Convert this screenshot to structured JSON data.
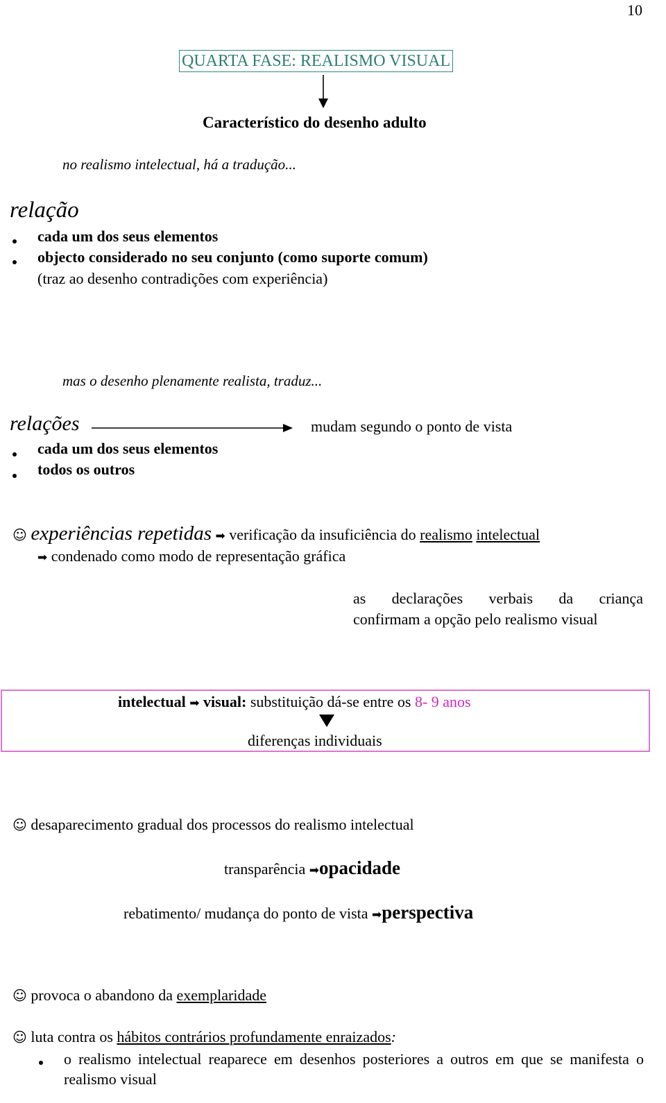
{
  "page_number": "10",
  "title": "QUARTA FASE: REALISMO VISUAL",
  "colors": {
    "title_border": "#2e8b7a",
    "title_text": "#2e7f73",
    "box_border": "#d977d0",
    "age_highlight": "#d227c0"
  },
  "subtitle": "Característico do desenho adulto",
  "intro_intellectual": "no realismo intelectual, há a tradução...",
  "relacao": {
    "heading": "relação",
    "bullets": [
      "cada um dos seus elementos",
      "objecto considerado no seu conjunto (como suporte comum)"
    ],
    "note": "(traz ao desenho contradições com experiência)"
  },
  "intro_visual": "mas o desenho plenamente realista, traduz...",
  "relacoes": {
    "heading": "relações",
    "arrow_target": "mudam segundo o ponto de vista",
    "bullets": [
      "cada um dos seus elementos",
      "todos os outros"
    ]
  },
  "icons": {
    "smiley": "☺",
    "arrow": "➡"
  },
  "experiences": {
    "lead": "experiências repetidas",
    "text_before": "verificação da insuficiência do",
    "underlined_1": "realismo",
    "underlined_2": "intelectual",
    "continuation": "condenado como modo de representação gráfica"
  },
  "declarations": {
    "line1_words": [
      "as",
      "declarações",
      "verbais",
      "da",
      "criança"
    ],
    "line2": "confirmam a opção pelo realismo visual"
  },
  "box": {
    "bold_from": "intelectual",
    "bold_to": "visual:",
    "text": "substituição dá-se entre os",
    "age": "8- 9 anos",
    "result": "diferenças individuais"
  },
  "disappearance": "desaparecimento gradual dos processos do realismo intelectual",
  "transparency": {
    "from": "transparência",
    "to": "opacidade"
  },
  "rebatimento": {
    "from": "rebatimento/ mudança do ponto de vista",
    "to": "perspectiva"
  },
  "provoca": {
    "text": "provoca o abandono da",
    "underlined": "exemplaridade"
  },
  "luta": {
    "text": "luta contra os",
    "underlined": "hábitos contrários profundamente enraizados",
    "suffix": ":",
    "bullet": "o realismo intelectual reaparece em desenhos posteriores a outros em que se manifesta o realismo visual"
  }
}
